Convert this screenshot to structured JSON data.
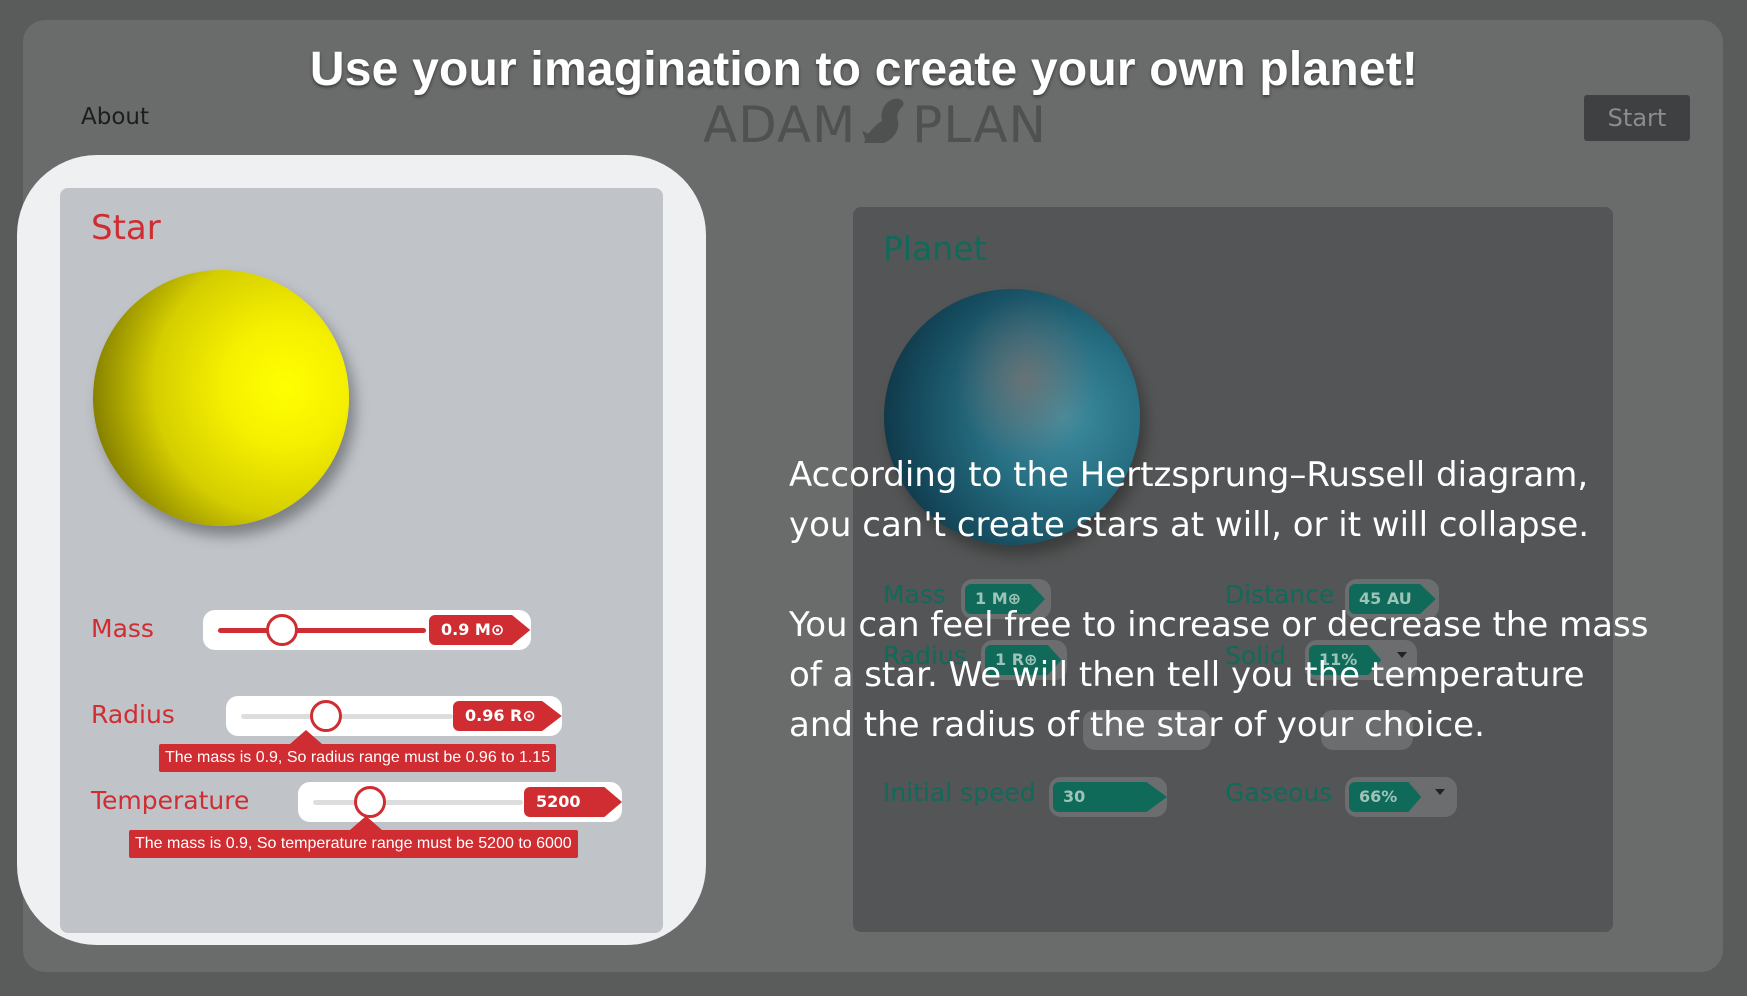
{
  "headline": "Use your imagination to create your own planet!",
  "nav": {
    "about_label": "About",
    "logo_left": "ADAM",
    "logo_right": "PLAN",
    "start_label": "Start"
  },
  "star": {
    "title": "Star",
    "mass": {
      "label": "Mass",
      "value": "0.9 M⊙",
      "fraction": 0.31
    },
    "radius": {
      "label": "Radius",
      "value": "0.96 R⊙",
      "fraction": 0.4,
      "tooltip": "The mass is 0.9, So radius range must be 0.96 to 1.15"
    },
    "temperature": {
      "label": "Temperature",
      "value": "5200 K",
      "fraction": 0.27,
      "tooltip": "The mass is 0.9, So temperature range must be 5200 to 6000"
    }
  },
  "planet": {
    "title": "Planet",
    "mass": {
      "label": "Mass",
      "value": "1 M⊕"
    },
    "distance": {
      "label": "Distance",
      "value": "45 AU"
    },
    "radius": {
      "label": "Radius",
      "value": "1 R⊕"
    },
    "solid": {
      "label": "Solid",
      "value": "11%"
    },
    "initial_speed": {
      "label": "Initial speed",
      "value": "30 Deg/H"
    },
    "gaseous": {
      "label": "Gaseous",
      "value": "66%"
    }
  },
  "overlay": {
    "line1": "According to the Hertzsprung–Russell diagram,",
    "line2": "you can't create stars at will, or it will collapse.",
    "line3": "You can feel free to increase or decrease the mass",
    "line4": "of a star. We will then tell you the temperature",
    "line5": "and the radius of the star of your choice."
  },
  "colors": {
    "accent_red": "#cf2d31",
    "accent_teal": "#0f6a5a",
    "star_yellow": "#ffff00"
  }
}
